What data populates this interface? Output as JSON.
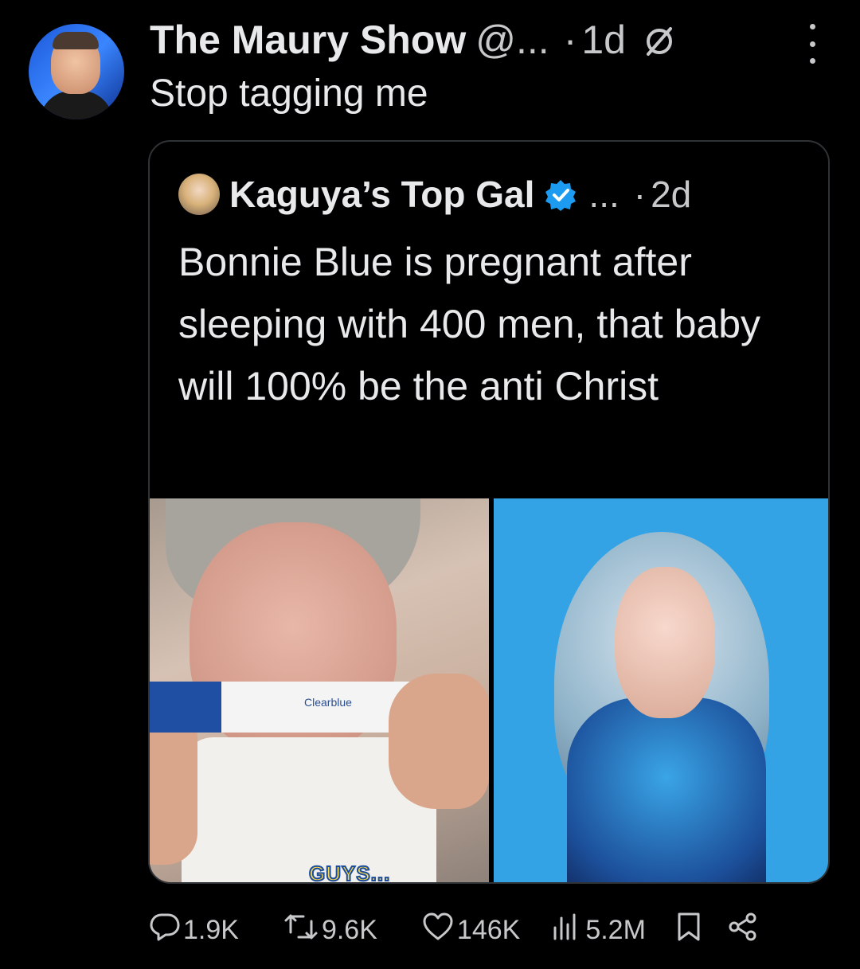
{
  "tweet": {
    "author_name": "The Maury Show",
    "author_handle": "@...",
    "separator": "·",
    "time": "1d",
    "text": "Stop tagging me"
  },
  "quoted_tweet": {
    "author_name": "Kaguya’s Top Gal",
    "author_handle": "...",
    "separator": "·",
    "time": "2d",
    "text": "Bonnie Blue is pregnant after sleeping with 400 men, that baby will 100% be the anti Christ",
    "media": {
      "left_caption": "GUYS...",
      "test_brand": "Clearblue"
    }
  },
  "actions": {
    "replies": "1.9K",
    "retweets": "9.6K",
    "likes": "146K",
    "views": "5.2M"
  },
  "icons": {
    "reply": "reply-icon",
    "retweet": "retweet-icon",
    "like": "heart-icon",
    "views": "views-icon",
    "bookmark": "bookmark-icon",
    "share": "share-icon",
    "more": "more-icon",
    "verified": "verified-icon",
    "no_notify": "slash-icon"
  },
  "colors": {
    "background": "#000000",
    "text": "#e7e9ea",
    "secondary_text": "#c6c8ca",
    "verified": "#1d9bf0",
    "border": "#2f3336"
  }
}
